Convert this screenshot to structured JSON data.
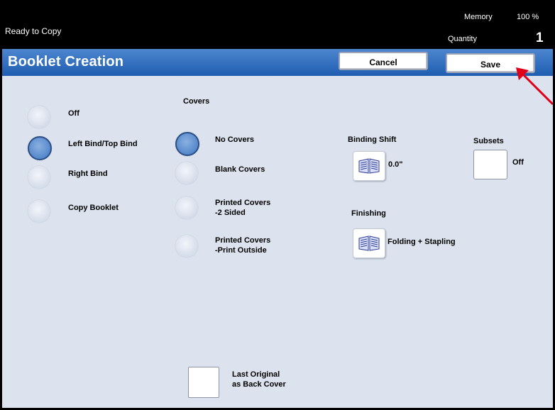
{
  "status": {
    "text": "Ready to Copy",
    "memory_label": "Memory",
    "memory_value": "100 %",
    "quantity_label": "Quantity",
    "quantity_value": "1"
  },
  "title": "Booklet Creation",
  "buttons": {
    "cancel": "Cancel",
    "save": "Save"
  },
  "bind_options": [
    {
      "label": "Off",
      "selected": false
    },
    {
      "label": "Left Bind/Top Bind",
      "selected": true
    },
    {
      "label": "Right Bind",
      "selected": false
    },
    {
      "label": "Copy Booklet",
      "selected": false
    }
  ],
  "covers": {
    "heading": "Covers",
    "options": [
      {
        "line1": "No Covers",
        "line2": "",
        "selected": true
      },
      {
        "line1": "Blank Covers",
        "line2": "",
        "selected": false
      },
      {
        "line1": "Printed Covers",
        "line2": "-2 Sided",
        "selected": false
      },
      {
        "line1": "Printed Covers",
        "line2": "-Print Outside",
        "selected": false
      }
    ]
  },
  "binding_shift": {
    "heading": "Binding Shift",
    "value": "0.0\""
  },
  "subsets": {
    "heading": "Subsets",
    "value": "Off"
  },
  "finishing": {
    "heading": "Finishing",
    "value": "Folding + Stapling"
  },
  "last_original": {
    "line1": "Last Original",
    "line2": "as Back Cover"
  },
  "colors": {
    "title_bar": "#2a66b8",
    "panel": "#dde3ee",
    "selected_radio": "#3f77c2",
    "annotation_arrow": "#e0001a"
  },
  "icons": [
    "booklet-icon",
    "booklet-icon",
    "arrow-pointer-icon"
  ]
}
